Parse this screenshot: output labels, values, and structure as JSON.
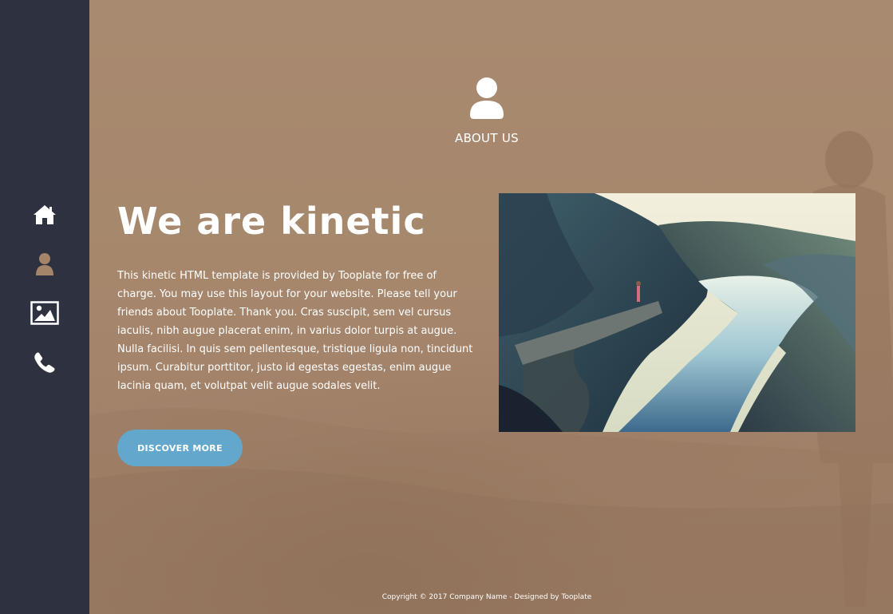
{
  "sidebar": {
    "items": [
      {
        "icon": "home-icon",
        "active": false
      },
      {
        "icon": "user-icon",
        "active": true
      },
      {
        "icon": "image-icon",
        "active": false
      },
      {
        "icon": "phone-icon",
        "active": false
      }
    ]
  },
  "section": {
    "icon": "user-icon",
    "title": "ABOUT US"
  },
  "main": {
    "headline": "We are kinetic",
    "body": "This kinetic HTML template is provided by Tooplate for free of charge. You may use this layout for your website. Please tell your friends about Tooplate. Thank you. Cras suscipit, sem vel cursus iaculis, nibh augue placerat enim, in varius dolor turpis at augue. Nulla facilisi. In quis sem pellentesque, tristique ligula non, tincidunt ipsum. Curabitur porttitor, justo id egestas egestas, enim augue lacinia quam, et volutpat velit augue sodales velit.",
    "button_label": "DISCOVER MORE"
  },
  "footer": {
    "copyright": "Copyright © 2017 Company Name - Designed by Tooplate"
  },
  "colors": {
    "sidebar_bg": "#2e3140",
    "page_bg": "#a5856a",
    "accent_active_icon": "#a5856a",
    "button_bg": "#63a8cc",
    "text": "#ffffff"
  }
}
